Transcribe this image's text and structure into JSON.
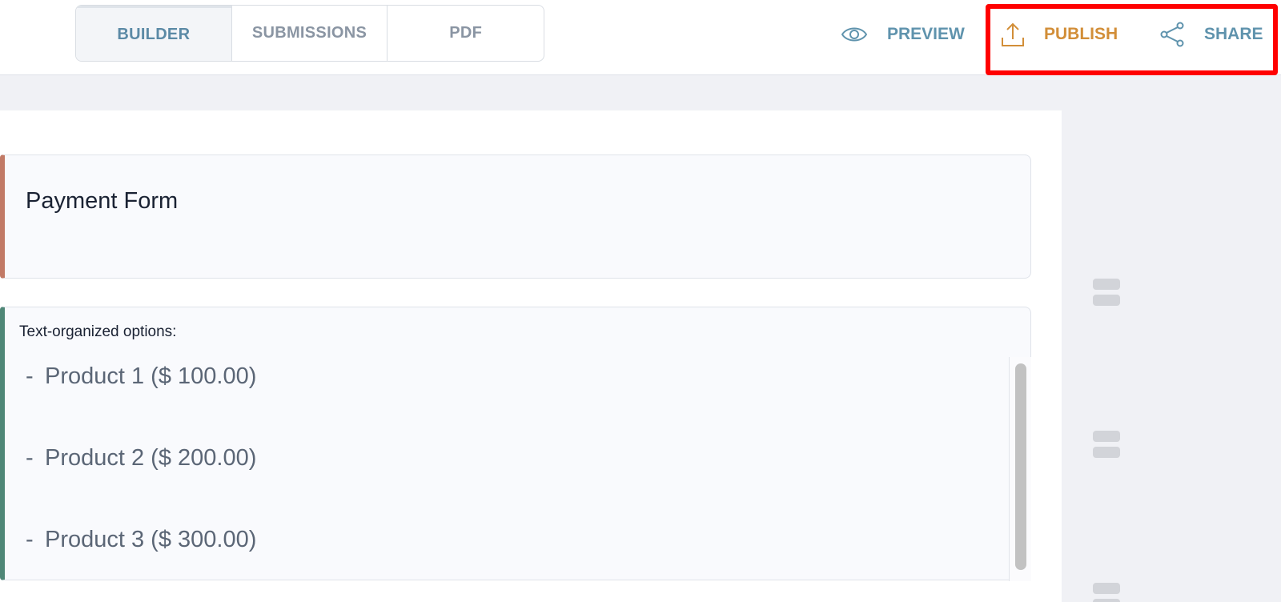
{
  "tabs": [
    {
      "label": "BUILDER",
      "active": true
    },
    {
      "label": "SUBMISSIONS",
      "active": false
    },
    {
      "label": "PDF",
      "active": false
    }
  ],
  "actions": {
    "preview": {
      "label": "PREVIEW",
      "icon": "eye-icon",
      "color": "#5f93ad"
    },
    "publish": {
      "label": "PUBLISH",
      "icon": "upload-icon",
      "color": "#d28e38"
    },
    "share": {
      "label": "SHARE",
      "icon": "share-icon",
      "color": "#5f93ad"
    }
  },
  "form": {
    "title": "Payment Form",
    "options_label": "Text-organized options:",
    "options": [
      {
        "dash": "-",
        "text": "Product 1 ($ 100.00)"
      },
      {
        "dash": "-",
        "text": "Product 2 ($ 200.00)"
      },
      {
        "dash": "-",
        "text": "Product 3 ($ 300.00)"
      }
    ]
  },
  "colors": {
    "highlight": "#ff0000",
    "title_card_accent": "#c27a66",
    "options_card_accent": "#4f8777"
  }
}
